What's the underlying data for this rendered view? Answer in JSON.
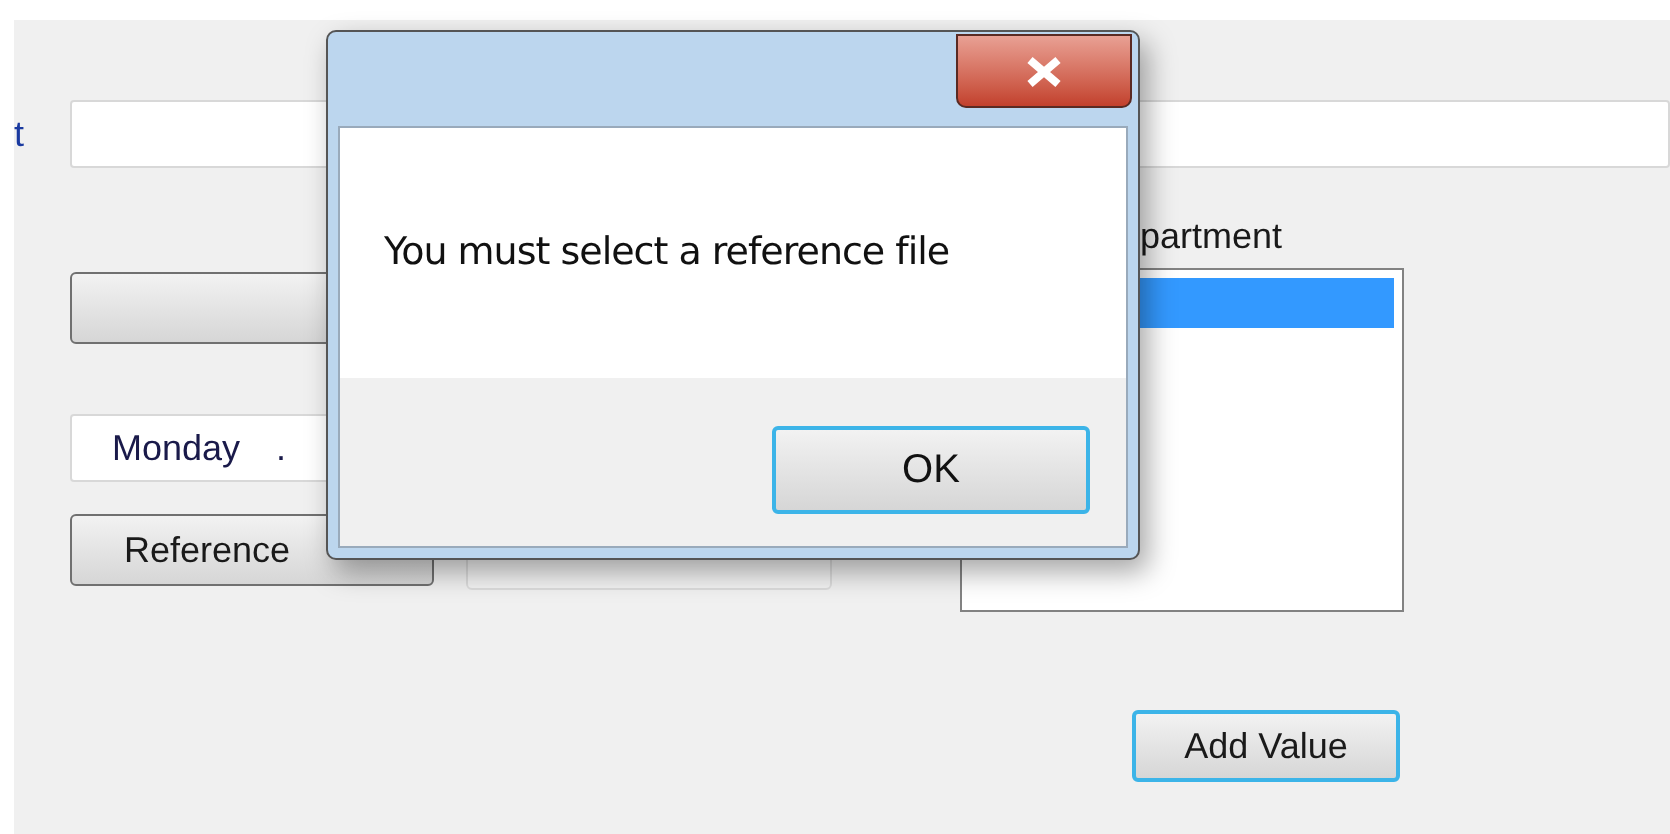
{
  "form": {
    "field_label": "t",
    "day_field": {
      "value": "Monday",
      "separator": "."
    },
    "reference_button": "Reference",
    "list_label": "partment",
    "list_items": [
      {
        "selected": true
      }
    ],
    "add_button": "Add Value"
  },
  "dialog": {
    "message": "You must select a reference file",
    "ok_button": "OK"
  }
}
